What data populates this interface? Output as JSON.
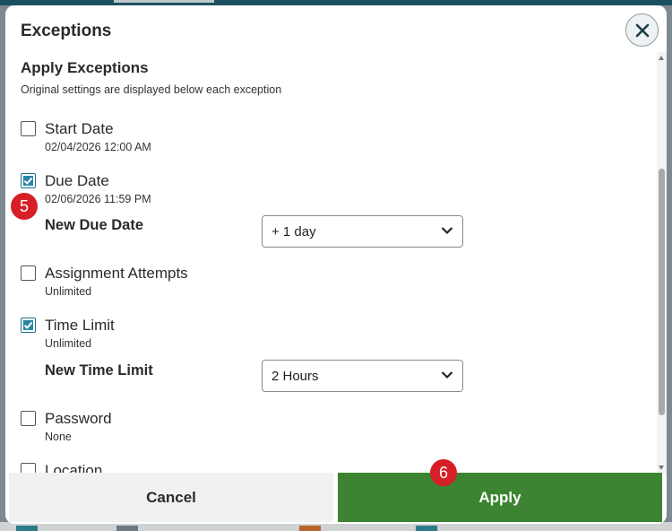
{
  "dialog": {
    "title": "Exceptions",
    "section_title": "Apply Exceptions",
    "section_subtitle": "Original settings are displayed below each exception",
    "options": [
      {
        "label": "Start Date",
        "original": "02/04/2026 12:00 AM",
        "checked": false
      },
      {
        "label": "Due Date",
        "original": "02/06/2026 11:59 PM",
        "checked": true,
        "new_label": "New Due Date",
        "new_value": "+ 1 day"
      },
      {
        "label": "Assignment Attempts",
        "original": "Unlimited",
        "checked": false
      },
      {
        "label": "Time Limit",
        "original": "Unlimited",
        "checked": true,
        "new_label": "New Time Limit",
        "new_value": "2 Hours"
      },
      {
        "label": "Password",
        "original": "None",
        "checked": false
      },
      {
        "label": "Location",
        "checked": false
      }
    ],
    "buttons": {
      "cancel": "Cancel",
      "apply": "Apply"
    }
  },
  "markers": {
    "step_5": "5",
    "step_6": "6"
  },
  "colors": {
    "apply": "#3c8431",
    "checkbox": "#2a86a6",
    "marker": "#d61f26",
    "header_bar": "#1b5060"
  },
  "icons": {
    "close": "close-icon",
    "dropdown": "chevron-down-icon",
    "check": "checkmark-icon"
  }
}
